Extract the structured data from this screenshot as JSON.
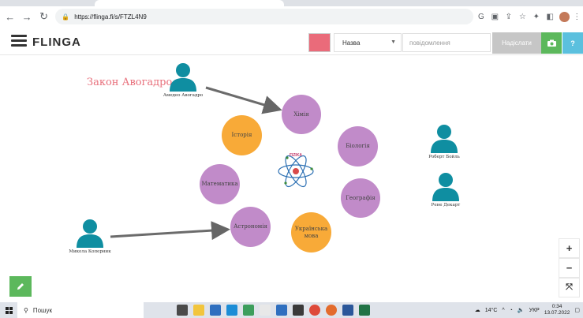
{
  "browser": {
    "url": "https://flinga.fi/s/FTZL4N9",
    "icons": [
      "back-icon",
      "forward-icon",
      "reload-icon",
      "lock-icon",
      "translate-icon",
      "cast-icon",
      "share-icon",
      "star-icon",
      "extension-icon",
      "sidebar-icon",
      "profile-avatar",
      "menu-icon"
    ]
  },
  "app": {
    "logo": "FLINGA",
    "name_select": "Назва",
    "message_placeholder": "повідомлення",
    "send_label": "Надіслати",
    "help_label": "?",
    "accent_color": "#ea6b7a"
  },
  "board": {
    "title": "Закон Авогадро",
    "bubbles": [
      {
        "label": "Хімія",
        "color": "purple"
      },
      {
        "label": "Історія",
        "color": "orange"
      },
      {
        "label": "Біологія",
        "color": "purple"
      },
      {
        "label": "Математика",
        "color": "purple"
      },
      {
        "label": "Географія",
        "color": "purple"
      },
      {
        "label": "Астрономія",
        "color": "purple"
      },
      {
        "label": "Українська мова",
        "color": "orange"
      }
    ],
    "people": [
      {
        "name": "Амедео Авогадро"
      },
      {
        "name": "Роберт Бойль"
      },
      {
        "name": "Рене Декарт"
      },
      {
        "name": "Микола Коперник"
      }
    ],
    "center_logo_text": "FIZIKA"
  },
  "controls": {
    "zoom_in": "+",
    "zoom_out": "−",
    "fit": "⤧"
  },
  "taskbar": {
    "search_label": "Пошук",
    "temperature": "14°C",
    "language": "УКР",
    "time": "0:34",
    "date": "13.07.2022"
  }
}
